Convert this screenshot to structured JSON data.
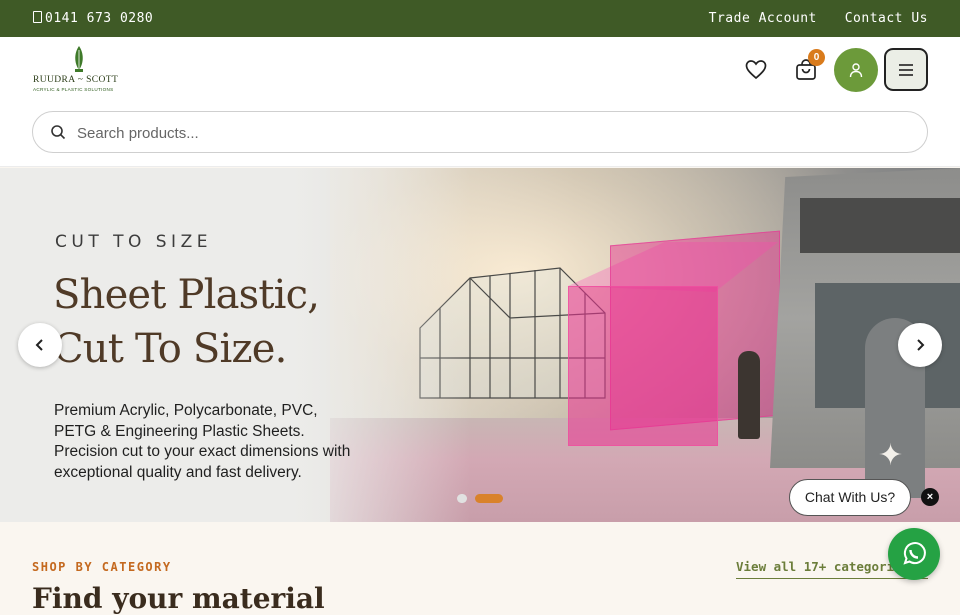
{
  "topbar": {
    "phone": "0141 673 0280",
    "trade_account": "Trade Account",
    "contact_us": "Contact Us"
  },
  "logo": {
    "name": "RUUDRA ~ SCOTT",
    "tagline": "ACRYLIC & PLASTIC SOLUTIONS"
  },
  "header": {
    "cart_count": "0",
    "search_placeholder": "Search products..."
  },
  "hero": {
    "eyebrow": "CUT TO SIZE",
    "title_line1": "Sheet Plastic,",
    "title_line2": "Cut To Size.",
    "description": "Premium Acrylic, Polycarbonate, PVC, PETG & Engineering Plastic Sheets. Precision cut to your exact dimensions with exceptional quality and fast delivery.",
    "active_slide": 2,
    "slide_count": 2
  },
  "chat": {
    "bubble": "Chat With Us?",
    "close": "×"
  },
  "category": {
    "label": "SHOP BY CATEGORY",
    "view_all": "View all 17+ categories",
    "heading": "Find your material"
  },
  "colors": {
    "topbar": "#3f5a26",
    "accent_orange": "#d97b1c",
    "account_green": "#6c9a3a",
    "whatsapp": "#25a244"
  },
  "icons": [
    "phone-icon",
    "heart-icon",
    "cart-icon",
    "user-icon",
    "menu-icon",
    "search-icon",
    "chevron-left-icon",
    "chevron-right-icon",
    "whatsapp-icon"
  ]
}
